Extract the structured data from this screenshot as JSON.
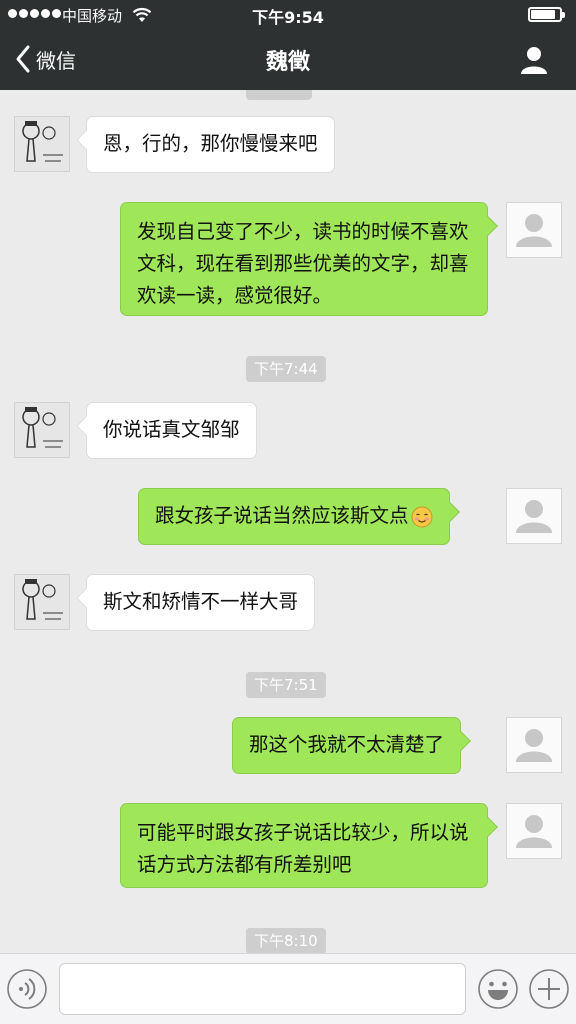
{
  "status_bar": {
    "carrier": "中国移动",
    "time": "下午9:54",
    "battery_level": 0.85
  },
  "nav": {
    "back_label": "微信",
    "title": "魏徵"
  },
  "messages": [
    {
      "kind": "in",
      "text": "恩，行的，那你慢慢来吧"
    },
    {
      "kind": "out",
      "text": "发现自己变了不少，读书的时候不喜欢文科，现在看到那些优美的文字，却喜欢读一读，感觉很好。"
    },
    {
      "kind": "time",
      "text": "下午7:44"
    },
    {
      "kind": "in",
      "text": "你说话真文邹邹"
    },
    {
      "kind": "out",
      "text": "跟女孩子说话当然应该斯文点",
      "emoji": "smile-emoji"
    },
    {
      "kind": "in",
      "text": "斯文和矫情不一样大哥"
    },
    {
      "kind": "time",
      "text": "下午7:51"
    },
    {
      "kind": "out",
      "text": "那这个我就不太清楚了"
    },
    {
      "kind": "out",
      "text": "可能平时跟女孩子说话比较少，所以说话方式方法都有所差别吧"
    },
    {
      "kind": "time",
      "text": "下午8:10"
    }
  ],
  "colors": {
    "header_bg": "#2e3132",
    "chat_bg": "#ebebeb",
    "outgoing_bubble": "#9fe658",
    "incoming_bubble": "#ffffff",
    "timestamp_bg": "#cecece"
  },
  "icons": {
    "back": "chevron-left-icon",
    "profile": "person-icon",
    "voice": "voice-icon",
    "emoji": "emoji-face-icon",
    "plus": "plus-icon"
  }
}
